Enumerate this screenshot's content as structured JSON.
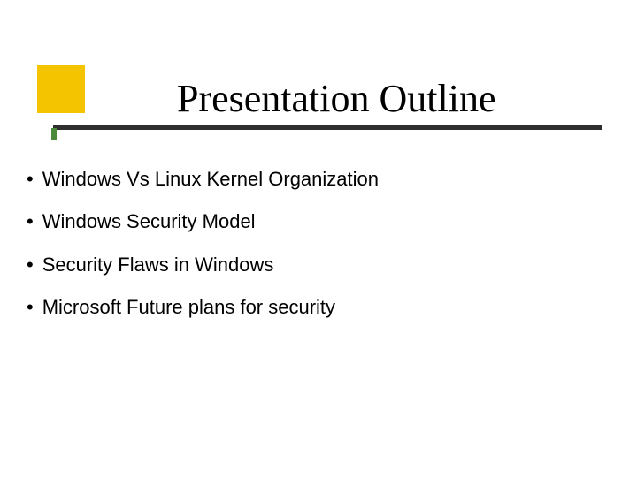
{
  "title": "Presentation Outline",
  "bullets": [
    "Windows Vs Linux Kernel Organization",
    "Windows Security Model",
    "Security Flaws in Windows",
    "Microsoft Future plans for security"
  ]
}
